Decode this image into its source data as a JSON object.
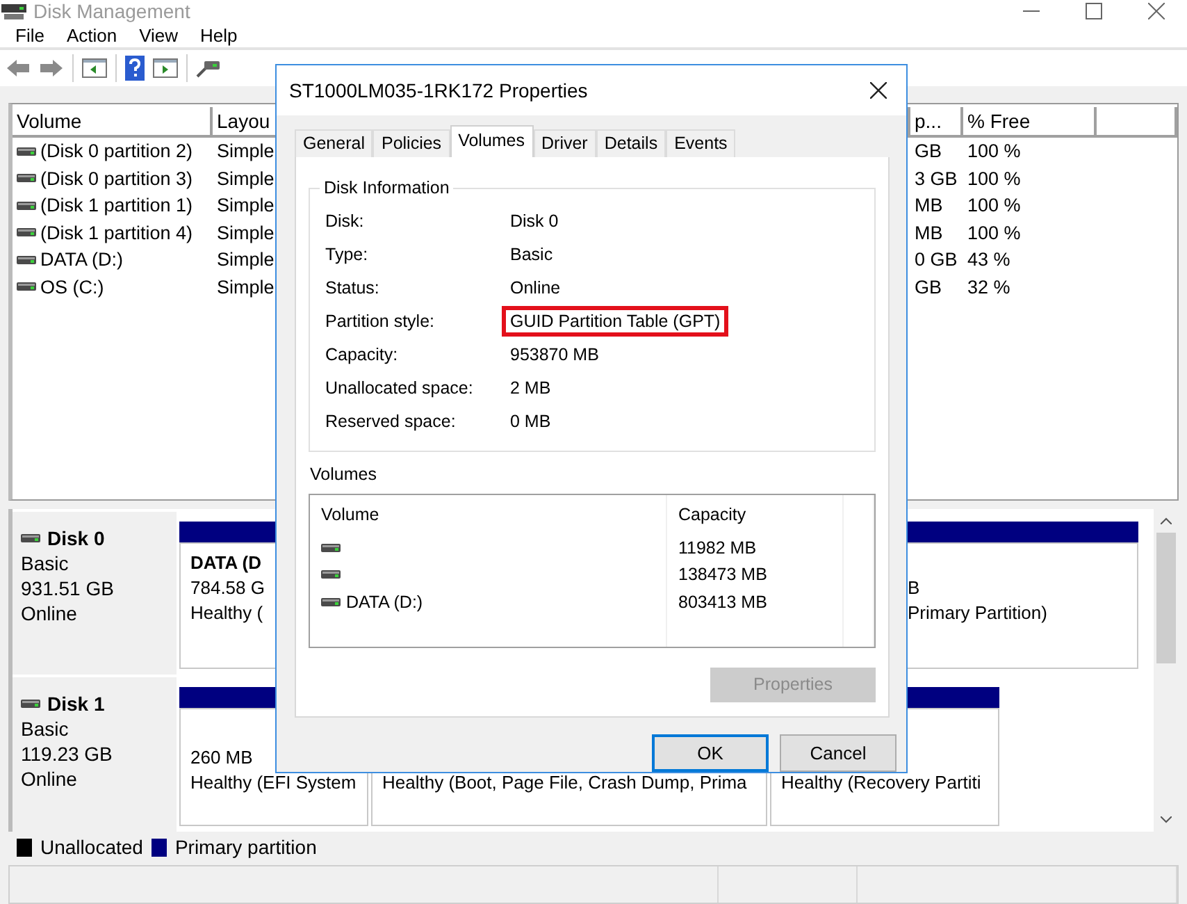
{
  "window": {
    "title": "Disk Management",
    "menu": [
      "File",
      "Action",
      "View",
      "Help"
    ]
  },
  "volume_list": {
    "columns": [
      "Volume",
      "Layou",
      "p...",
      "% Free"
    ],
    "rows": [
      {
        "volume": "(Disk 0 partition 2)",
        "layout": "Simple",
        "column_3": "GB",
        "percent_free": "100 %"
      },
      {
        "volume": "(Disk 0 partition 3)",
        "layout": "Simple",
        "column_3": "3 GB",
        "percent_free": "100 %"
      },
      {
        "volume": "(Disk 1 partition 1)",
        "layout": "Simple",
        "column_3": "MB",
        "percent_free": "100 %"
      },
      {
        "volume": "(Disk 1 partition 4)",
        "layout": "Simple",
        "column_3": "MB",
        "percent_free": "100 %"
      },
      {
        "volume": "DATA (D:)",
        "layout": "Simple",
        "column_3": "0 GB",
        "percent_free": "43 %"
      },
      {
        "volume": "OS (C:)",
        "layout": "Simple",
        "column_3": "GB",
        "percent_free": "32 %"
      }
    ]
  },
  "disks": [
    {
      "name": "Disk 0",
      "type": "Basic",
      "size": "931.51 GB",
      "status": "Online",
      "partitions": [
        {
          "title": "DATA  (D",
          "size": "784.58 G",
          "status": "Healthy ("
        },
        {
          "size": "B",
          "status": "Primary Partition)"
        }
      ]
    },
    {
      "name": "Disk 1",
      "type": "Basic",
      "size": "119.23 GB",
      "status": "Online",
      "partitions": [
        {
          "size": "260 MB",
          "status": "Healthy (EFI System"
        },
        {
          "status": "Healthy (Boot, Page File, Crash Dump, Prima"
        },
        {
          "status": "Healthy (Recovery Partiti"
        }
      ]
    }
  ],
  "legend": [
    {
      "label": "Unallocated",
      "color": "#000000"
    },
    {
      "label": "Primary partition",
      "color": "#000080"
    }
  ],
  "dialog": {
    "title": "ST1000LM035-1RK172 Properties",
    "tabs": [
      {
        "label": "General",
        "selected": false
      },
      {
        "label": "Policies",
        "selected": false
      },
      {
        "label": "Volumes",
        "selected": true
      },
      {
        "label": "Driver",
        "selected": false
      },
      {
        "label": "Details",
        "selected": false
      },
      {
        "label": "Events",
        "selected": false
      }
    ],
    "disk_information": {
      "title": "Disk Information",
      "fields": [
        {
          "label": "Disk:",
          "value": "Disk 0",
          "highlighted": false
        },
        {
          "label": "Type:",
          "value": "Basic",
          "highlighted": false
        },
        {
          "label": "Status:",
          "value": "Online",
          "highlighted": false
        },
        {
          "label": "Partition style:",
          "value": "GUID Partition Table (GPT)",
          "highlighted": true
        },
        {
          "label": "Capacity:",
          "value": "953870 MB",
          "highlighted": false
        },
        {
          "label": "Unallocated space:",
          "value": "2 MB",
          "highlighted": false
        },
        {
          "label": "Reserved space:",
          "value": "0 MB",
          "highlighted": false
        }
      ]
    },
    "volumes": {
      "title": "Volumes",
      "columns": [
        "Volume",
        "Capacity"
      ],
      "rows": [
        {
          "capacity": "11982 MB"
        },
        {
          "capacity": "138473 MB"
        },
        {
          "volume": "DATA (D:)",
          "capacity": "803413 MB"
        }
      ]
    },
    "properties_button": {
      "label": "Properties",
      "disabled": true
    },
    "buttons": [
      {
        "label": "OK",
        "default": true
      },
      {
        "label": "Cancel",
        "default": false
      }
    ]
  }
}
